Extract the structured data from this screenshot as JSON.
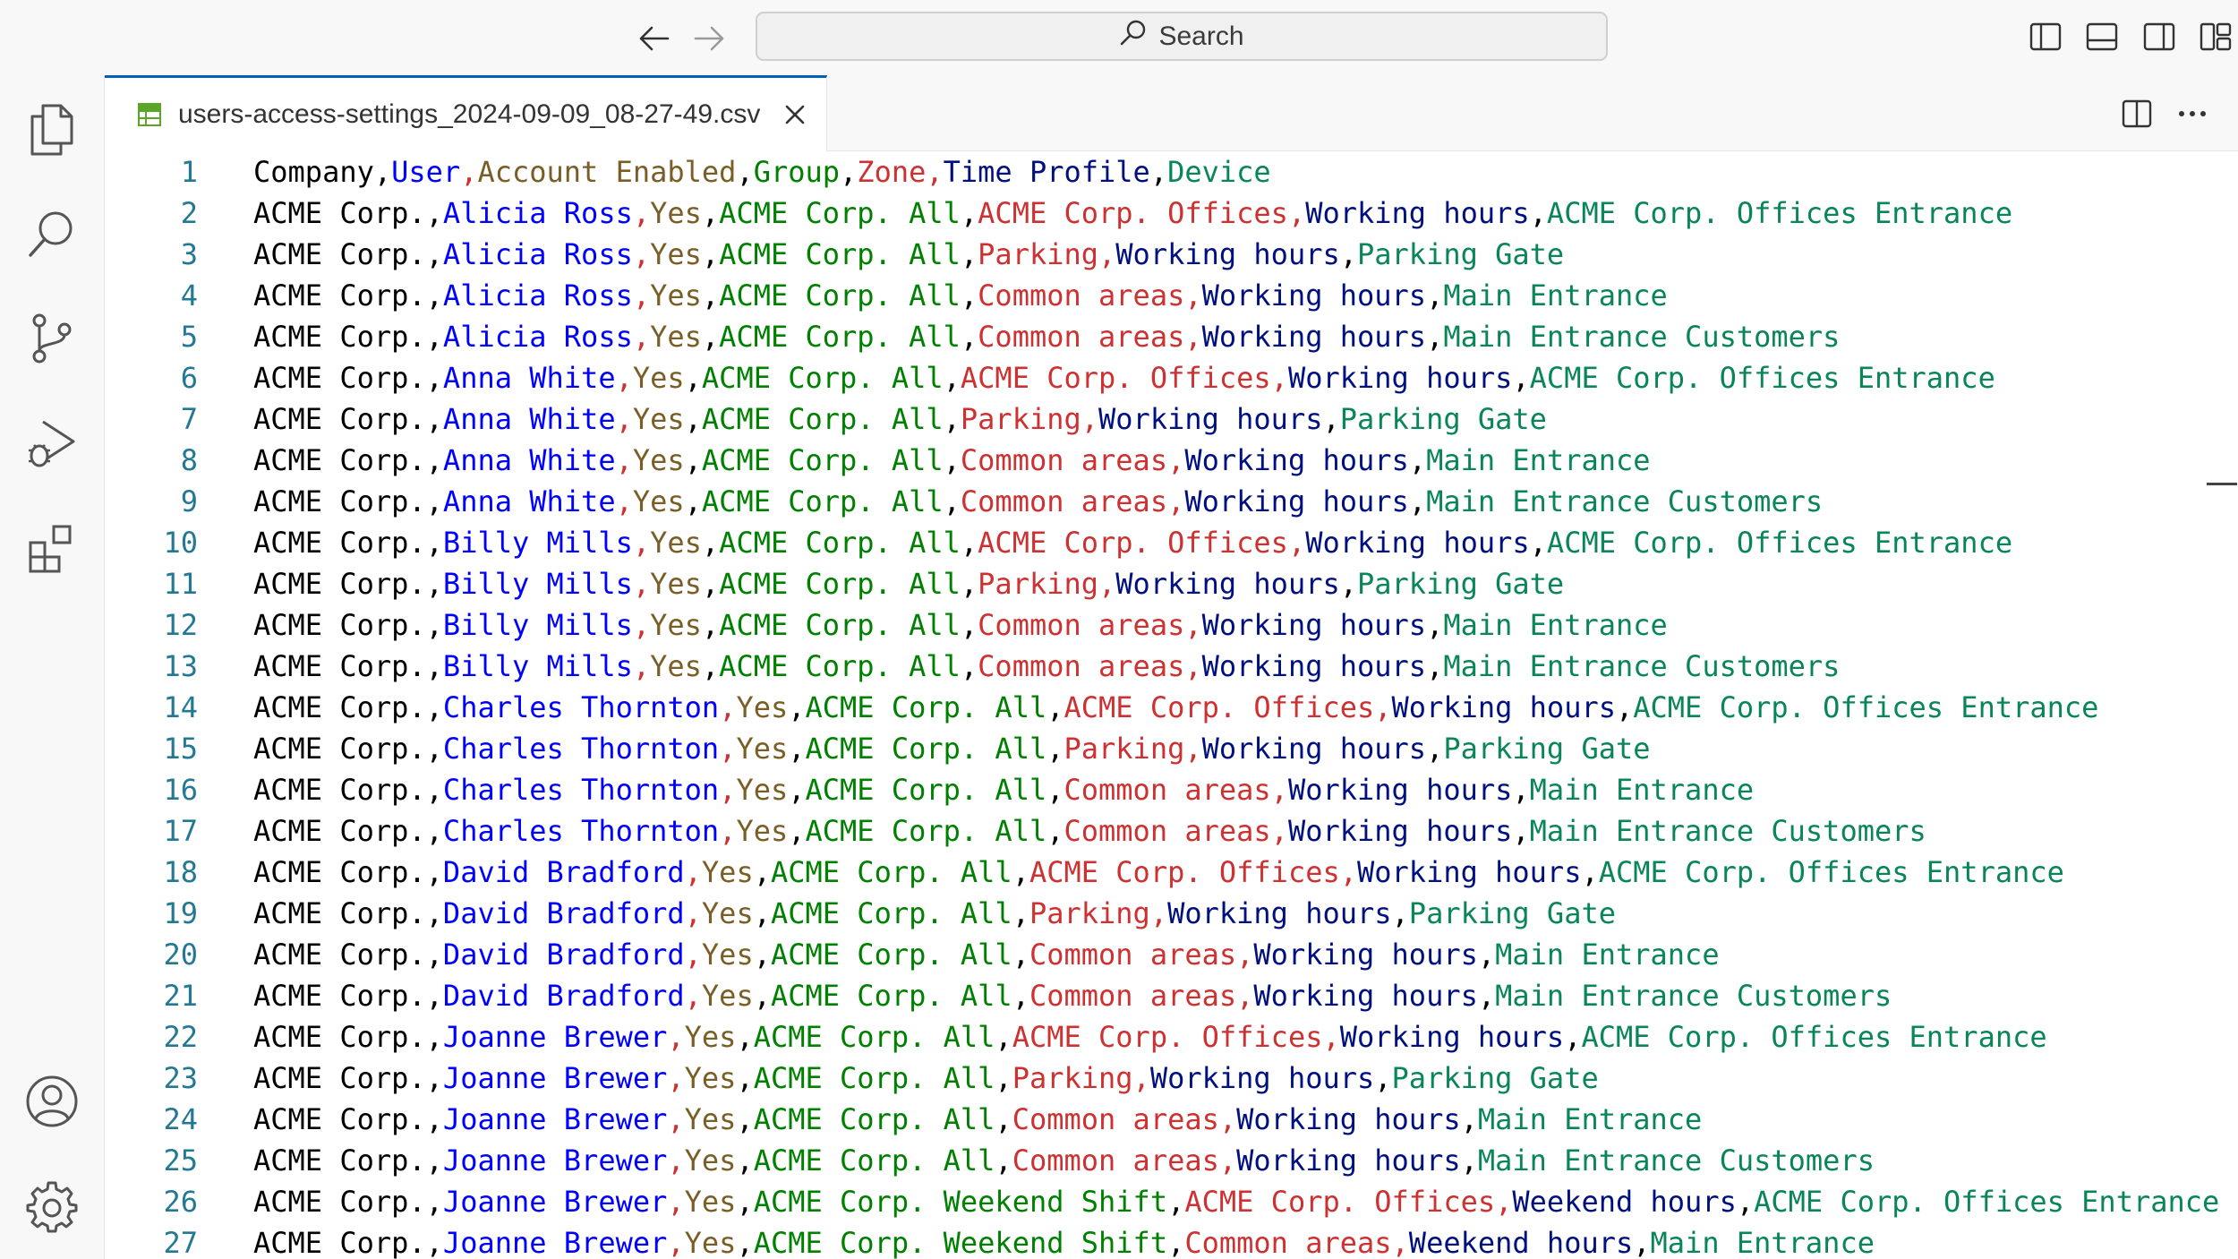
{
  "titlebar": {
    "search_placeholder": "Search"
  },
  "tab": {
    "title": "users-access-settings_2024-09-09_08-27-49.csv"
  },
  "colors": {
    "accent": "#005fb8",
    "line_number": "#237893",
    "column_colors": [
      "#000000",
      "#0000ff",
      "#795e26",
      "#008000",
      "#cd3131",
      "#001080",
      "#098658"
    ],
    "separator_colors": [
      "#000000",
      "#cd3131",
      "#000000",
      "#000000",
      "#cd3131",
      "#000000",
      "#000000"
    ]
  },
  "editor": {
    "lines": [
      {
        "n": "1",
        "cells": [
          "Company",
          "User",
          "Account Enabled",
          "Group",
          "Zone",
          "Time Profile",
          "Device"
        ]
      },
      {
        "n": "2",
        "cells": [
          "ACME Corp.",
          "Alicia Ross",
          "Yes",
          "ACME Corp. All",
          "ACME Corp. Offices",
          "Working hours",
          "ACME Corp. Offices Entrance"
        ]
      },
      {
        "n": "3",
        "cells": [
          "ACME Corp.",
          "Alicia Ross",
          "Yes",
          "ACME Corp. All",
          "Parking",
          "Working hours",
          "Parking Gate"
        ]
      },
      {
        "n": "4",
        "cells": [
          "ACME Corp.",
          "Alicia Ross",
          "Yes",
          "ACME Corp. All",
          "Common areas",
          "Working hours",
          "Main Entrance"
        ]
      },
      {
        "n": "5",
        "cells": [
          "ACME Corp.",
          "Alicia Ross",
          "Yes",
          "ACME Corp. All",
          "Common areas",
          "Working hours",
          "Main Entrance Customers"
        ]
      },
      {
        "n": "6",
        "cells": [
          "ACME Corp.",
          "Anna White",
          "Yes",
          "ACME Corp. All",
          "ACME Corp. Offices",
          "Working hours",
          "ACME Corp. Offices Entrance"
        ]
      },
      {
        "n": "7",
        "cells": [
          "ACME Corp.",
          "Anna White",
          "Yes",
          "ACME Corp. All",
          "Parking",
          "Working hours",
          "Parking Gate"
        ]
      },
      {
        "n": "8",
        "cells": [
          "ACME Corp.",
          "Anna White",
          "Yes",
          "ACME Corp. All",
          "Common areas",
          "Working hours",
          "Main Entrance"
        ]
      },
      {
        "n": "9",
        "cells": [
          "ACME Corp.",
          "Anna White",
          "Yes",
          "ACME Corp. All",
          "Common areas",
          "Working hours",
          "Main Entrance Customers"
        ]
      },
      {
        "n": "10",
        "cells": [
          "ACME Corp.",
          "Billy Mills",
          "Yes",
          "ACME Corp. All",
          "ACME Corp. Offices",
          "Working hours",
          "ACME Corp. Offices Entrance"
        ]
      },
      {
        "n": "11",
        "cells": [
          "ACME Corp.",
          "Billy Mills",
          "Yes",
          "ACME Corp. All",
          "Parking",
          "Working hours",
          "Parking Gate"
        ]
      },
      {
        "n": "12",
        "cells": [
          "ACME Corp.",
          "Billy Mills",
          "Yes",
          "ACME Corp. All",
          "Common areas",
          "Working hours",
          "Main Entrance"
        ]
      },
      {
        "n": "13",
        "cells": [
          "ACME Corp.",
          "Billy Mills",
          "Yes",
          "ACME Corp. All",
          "Common areas",
          "Working hours",
          "Main Entrance Customers"
        ]
      },
      {
        "n": "14",
        "cells": [
          "ACME Corp.",
          "Charles Thornton",
          "Yes",
          "ACME Corp. All",
          "ACME Corp. Offices",
          "Working hours",
          "ACME Corp. Offices Entrance"
        ]
      },
      {
        "n": "15",
        "cells": [
          "ACME Corp.",
          "Charles Thornton",
          "Yes",
          "ACME Corp. All",
          "Parking",
          "Working hours",
          "Parking Gate"
        ]
      },
      {
        "n": "16",
        "cells": [
          "ACME Corp.",
          "Charles Thornton",
          "Yes",
          "ACME Corp. All",
          "Common areas",
          "Working hours",
          "Main Entrance"
        ]
      },
      {
        "n": "17",
        "cells": [
          "ACME Corp.",
          "Charles Thornton",
          "Yes",
          "ACME Corp. All",
          "Common areas",
          "Working hours",
          "Main Entrance Customers"
        ]
      },
      {
        "n": "18",
        "cells": [
          "ACME Corp.",
          "David Bradford",
          "Yes",
          "ACME Corp. All",
          "ACME Corp. Offices",
          "Working hours",
          "ACME Corp. Offices Entrance"
        ]
      },
      {
        "n": "19",
        "cells": [
          "ACME Corp.",
          "David Bradford",
          "Yes",
          "ACME Corp. All",
          "Parking",
          "Working hours",
          "Parking Gate"
        ]
      },
      {
        "n": "20",
        "cells": [
          "ACME Corp.",
          "David Bradford",
          "Yes",
          "ACME Corp. All",
          "Common areas",
          "Working hours",
          "Main Entrance"
        ]
      },
      {
        "n": "21",
        "cells": [
          "ACME Corp.",
          "David Bradford",
          "Yes",
          "ACME Corp. All",
          "Common areas",
          "Working hours",
          "Main Entrance Customers"
        ]
      },
      {
        "n": "22",
        "cells": [
          "ACME Corp.",
          "Joanne Brewer",
          "Yes",
          "ACME Corp. All",
          "ACME Corp. Offices",
          "Working hours",
          "ACME Corp. Offices Entrance"
        ]
      },
      {
        "n": "23",
        "cells": [
          "ACME Corp.",
          "Joanne Brewer",
          "Yes",
          "ACME Corp. All",
          "Parking",
          "Working hours",
          "Parking Gate"
        ]
      },
      {
        "n": "24",
        "cells": [
          "ACME Corp.",
          "Joanne Brewer",
          "Yes",
          "ACME Corp. All",
          "Common areas",
          "Working hours",
          "Main Entrance"
        ]
      },
      {
        "n": "25",
        "cells": [
          "ACME Corp.",
          "Joanne Brewer",
          "Yes",
          "ACME Corp. All",
          "Common areas",
          "Working hours",
          "Main Entrance Customers"
        ]
      },
      {
        "n": "26",
        "cells": [
          "ACME Corp.",
          "Joanne Brewer",
          "Yes",
          "ACME Corp. Weekend Shift",
          "ACME Corp. Offices",
          "Weekend hours",
          "ACME Corp. Offices Entrance"
        ]
      },
      {
        "n": "27",
        "cells": [
          "ACME Corp.",
          "Joanne Brewer",
          "Yes",
          "ACME Corp. Weekend Shift",
          "Common areas",
          "Weekend hours",
          "Main Entrance"
        ]
      }
    ]
  }
}
